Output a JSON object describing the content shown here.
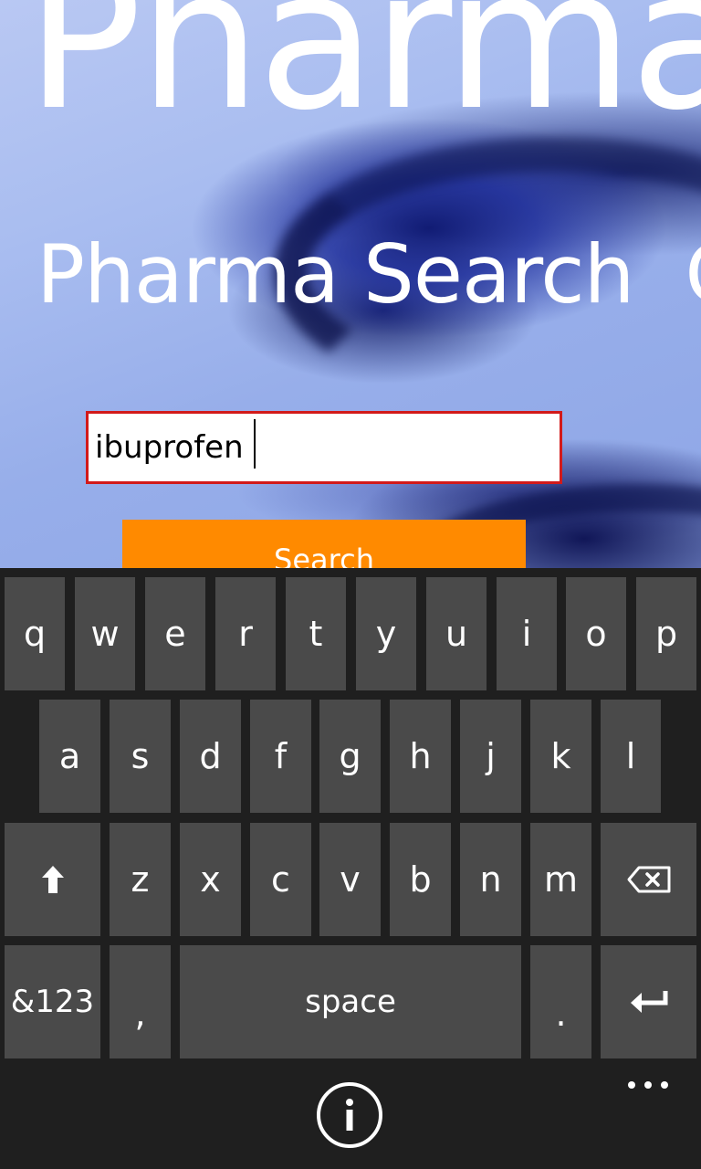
{
  "app": {
    "panorama_title": "Pharma",
    "current_page_title": "Pharma Search",
    "next_page_title_peek": "C"
  },
  "search": {
    "value": "ibuprofen",
    "button_label": "Search"
  },
  "colors": {
    "accent_orange": "#ff8a00",
    "input_border_red": "#d21a1a",
    "keyboard_bg": "#1f1f1f",
    "key_bg": "#4a4a4a"
  },
  "keyboard": {
    "row1": [
      "q",
      "w",
      "e",
      "r",
      "t",
      "y",
      "u",
      "i",
      "o",
      "p"
    ],
    "row2": [
      "a",
      "s",
      "d",
      "f",
      "g",
      "h",
      "j",
      "k",
      "l"
    ],
    "row3": [
      "z",
      "x",
      "c",
      "v",
      "b",
      "n",
      "m"
    ],
    "shift_icon": "shift-arrow-icon",
    "backspace_icon": "backspace-icon",
    "symbols_label": "&123",
    "comma_label": ",",
    "space_label": "space",
    "period_label": ".",
    "enter_icon": "enter-icon"
  },
  "app_bar": {
    "info_icon": "info-icon",
    "more_icon": "more-ellipsis-icon"
  }
}
